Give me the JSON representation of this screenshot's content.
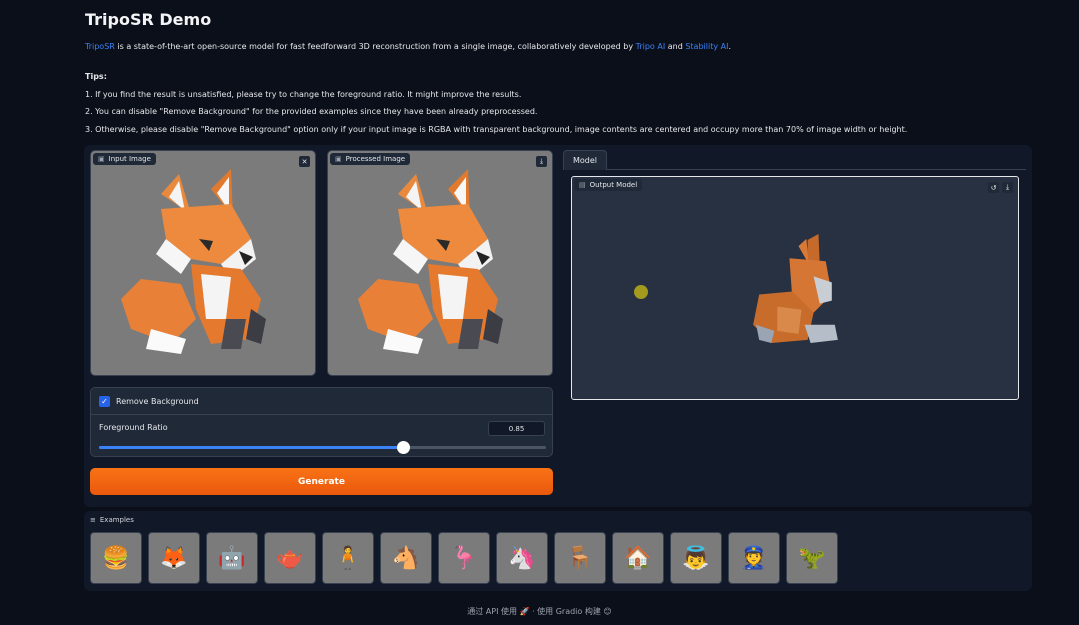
{
  "title": "TripoSR Demo",
  "description": {
    "link1": "TripoSR",
    "text1": " is a state-of-the-art open-source model for fast feedforward 3D reconstruction from a single image, collaboratively developed by ",
    "link2": "Tripo AI",
    "text2": " and ",
    "link3": "Stability AI",
    "text3": "."
  },
  "tips": {
    "heading": "Tips:",
    "items": [
      "1. If you find the result is unsatisfied, please try to change the foreground ratio. It might improve the results.",
      "2. You can disable \"Remove Background\" for the provided examples since they have been already preprocessed.",
      "3. Otherwise, please disable \"Remove Background\" option only if your input image is RGBA with transparent background, image contents are centered and occupy more than 70% of image width or height."
    ]
  },
  "input_image": {
    "label": "Input Image",
    "clear_icon": "close-icon"
  },
  "processed_image": {
    "label": "Processed Image",
    "download_icon": "download-icon"
  },
  "remove_background": {
    "label": "Remove Background",
    "checked": true
  },
  "foreground_ratio": {
    "label": "Foreground Ratio",
    "value": "0.85",
    "fraction": 0.68
  },
  "generate_label": "Generate",
  "model_tab": {
    "label": "Model"
  },
  "output_model": {
    "label": "Output Model",
    "reset_icon": "undo-icon",
    "download_icon": "download-icon"
  },
  "examples": {
    "label": "Examples",
    "items": [
      "🍔",
      "🦊",
      "🤖",
      "🫖",
      "🧍",
      "🐴",
      "🦩",
      "🦄",
      "🪑",
      "🏠",
      "👼",
      "👮",
      "🦖"
    ]
  },
  "footer": {
    "api": "通过 API 使用",
    "sep": "·",
    "built": "使用 Gradio 构建"
  }
}
